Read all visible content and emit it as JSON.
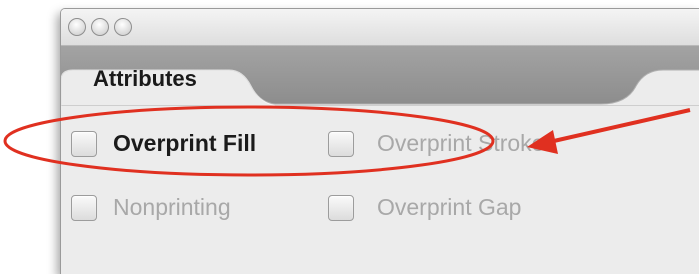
{
  "panel": {
    "tab": {
      "label": "Attributes"
    }
  },
  "options": [
    {
      "label": "Overprint Fill",
      "enabled": true,
      "checked": false
    },
    {
      "label": "Overprint Stroke",
      "enabled": false,
      "checked": false
    },
    {
      "label": "Nonprinting",
      "enabled": false,
      "checked": false
    },
    {
      "label": "Overprint Gap",
      "enabled": false,
      "checked": false
    }
  ],
  "annotation": {
    "color": "#e03020"
  }
}
